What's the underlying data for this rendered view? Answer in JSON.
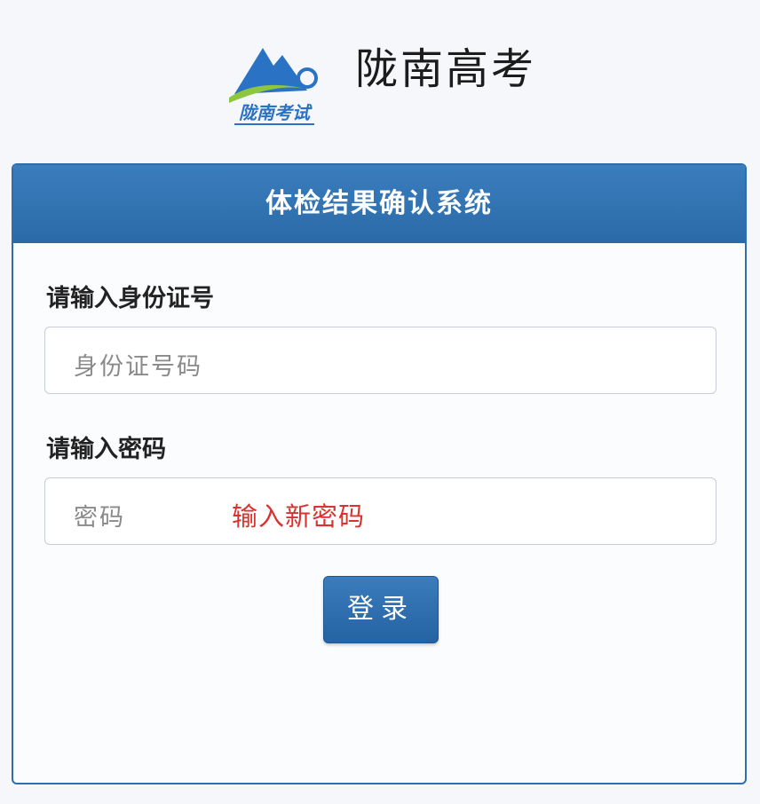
{
  "brand": {
    "logo_text": "陇南考试",
    "site_title": "陇南高考"
  },
  "panel": {
    "title": "体检结果确认系统"
  },
  "form": {
    "id_label": "请输入身份证号",
    "id_placeholder": "身份证号码",
    "password_label": "请输入密码",
    "password_placeholder": "密码",
    "password_annotation": "输入新密码",
    "login_label": "登录"
  },
  "colors": {
    "accent": "#2f6eaa",
    "annotation": "#d9322f"
  }
}
